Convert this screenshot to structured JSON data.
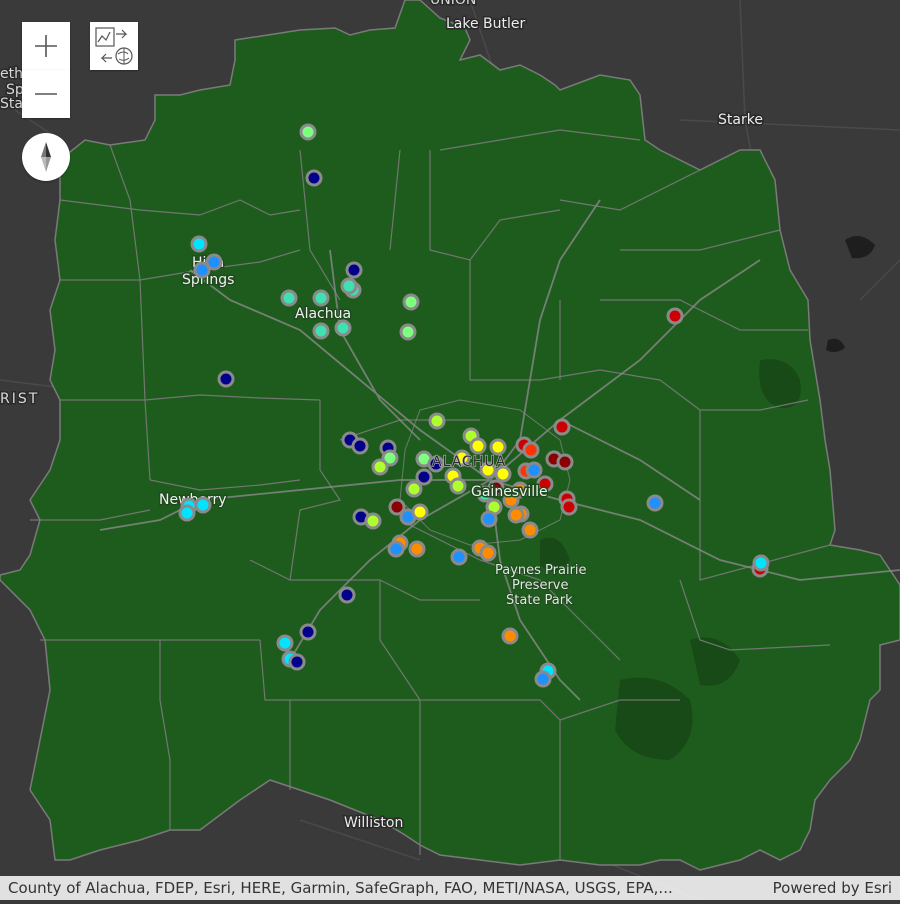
{
  "map": {
    "controls": {
      "zoom_in_icon": "plus-icon",
      "zoom_out_icon": "minus-icon",
      "compass_icon": "compass-icon",
      "basemap_icon": "basemap-toggle-icon"
    },
    "colors": {
      "county_fill": "#1e5c1e",
      "county_border": "#7a7a7a",
      "background": "#3a3a3a",
      "point_outline": "#8a8a8a"
    },
    "place_labels": {
      "lake_butler": "Lake Butler",
      "starke": "Starke",
      "high_springs_1": "High",
      "high_springs_2": "Springs",
      "alachua": "Alachua",
      "newberry": "Newberry",
      "gainesville": "Gainesville",
      "alachua_upper": "ALACHUA",
      "paynes_1": "Paynes Prairie",
      "paynes_2": "Preserve",
      "paynes_3": "State Park",
      "williston": "Williston",
      "union": "UNION",
      "crist": "RIST",
      "left_1": "ethe",
      "left_2": "Sp",
      "left_3": "Sta"
    },
    "legend_colors": [
      "#00008b",
      "#1e90ff",
      "#00e5ff",
      "#40e0b0",
      "#7fff7f",
      "#adff2f",
      "#ffff00",
      "#ffd700",
      "#ff8c00",
      "#ff3300",
      "#cc0000",
      "#8b0000"
    ]
  },
  "attribution": {
    "sources": "County of Alachua, FDEP, Esri, HERE, Garmin, SafeGraph, FAO, METI/NASA, USGS, EPA,...",
    "powered_by": "Powered by Esri"
  }
}
